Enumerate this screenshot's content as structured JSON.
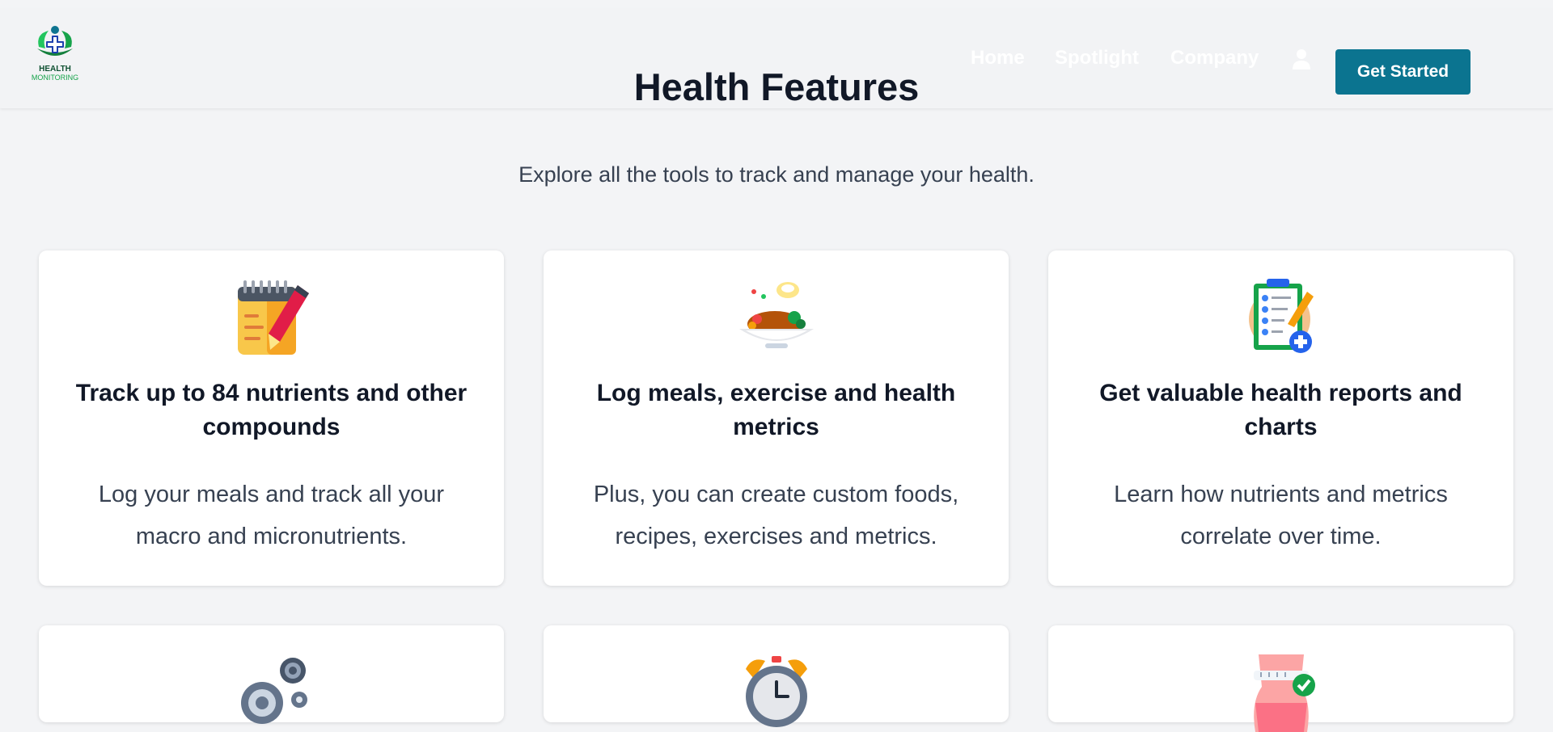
{
  "header": {
    "logo_text_line1": "HEALTH",
    "logo_text_line2": "MONITORING",
    "nav": [
      "Home",
      "Spotlight",
      "Company"
    ],
    "cta_label": "Get Started"
  },
  "page": {
    "title": "Health Features",
    "subtitle": "Explore all the tools to track and manage your health."
  },
  "features": [
    {
      "icon": "notepad-pen-icon",
      "title": "Track up to 84 nutrients and other compounds",
      "description": "Log your meals and track all your macro and micronutrients."
    },
    {
      "icon": "meal-bowl-icon",
      "title": "Log meals, exercise and health metrics",
      "description": "Plus, you can create custom foods, recipes, exercises and metrics."
    },
    {
      "icon": "clipboard-report-icon",
      "title": "Get valuable health reports and charts",
      "description": "Learn how nutrients and metrics correlate over time."
    },
    {
      "icon": "gears-icon"
    },
    {
      "icon": "alarm-clock-icon"
    },
    {
      "icon": "body-measure-icon"
    }
  ],
  "colors": {
    "background": "#f3f4f6",
    "accent": "#0b7490",
    "heading": "#111827",
    "body_text": "#374151"
  }
}
